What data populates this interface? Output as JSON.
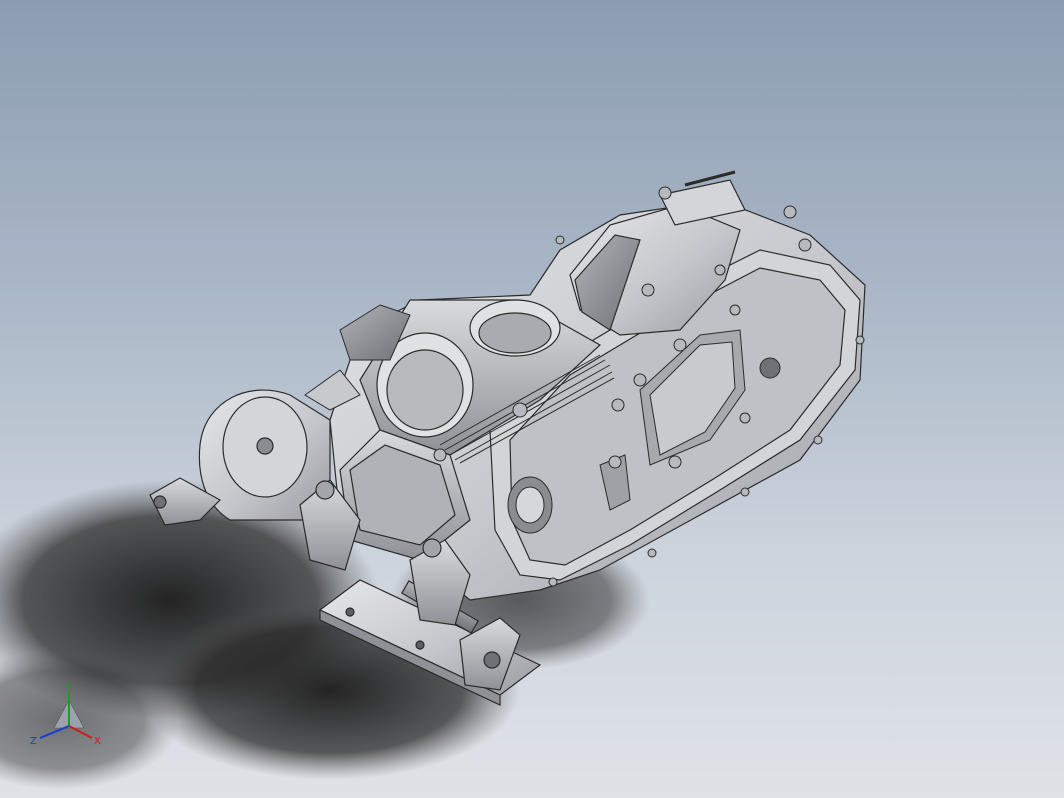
{
  "viewport": {
    "background_top": "#8c9db2",
    "background_bottom": "#dfe3e8",
    "part_color": "#c9cbd0",
    "edge_color": "#2b2b2b"
  },
  "triad": {
    "x_label": "X",
    "y_label": "Y",
    "z_label": "Z",
    "x_color": "#d11a1a",
    "y_color": "#1aa11a",
    "z_color": "#1a3bd1"
  }
}
